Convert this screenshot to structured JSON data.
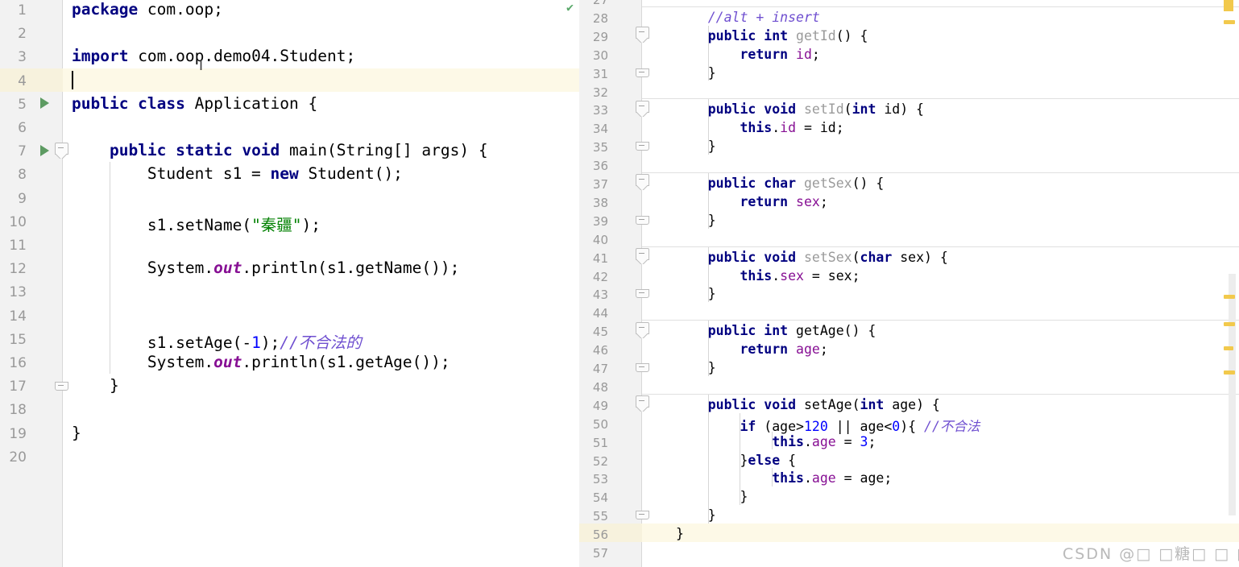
{
  "editor": {
    "left_pane": {
      "first_line": 1,
      "caret_line": 4,
      "run_marker_lines": [
        5,
        7
      ],
      "lines": [
        {
          "n": 1,
          "tokens": [
            {
              "t": "package",
              "c": "kw"
            },
            {
              "t": " com.oop;",
              "c": "pl"
            }
          ]
        },
        {
          "n": 2,
          "tokens": []
        },
        {
          "n": 3,
          "tokens": [
            {
              "t": "import",
              "c": "kw"
            },
            {
              "t": " com.oop.demo04.Student;",
              "c": "pl"
            }
          ]
        },
        {
          "n": 4,
          "tokens": []
        },
        {
          "n": 5,
          "tokens": [
            {
              "t": "public class",
              "c": "kw"
            },
            {
              "t": " Application {",
              "c": "pl"
            }
          ]
        },
        {
          "n": 6,
          "tokens": []
        },
        {
          "n": 7,
          "tokens": [
            {
              "t": "    ",
              "c": "pl"
            },
            {
              "t": "public static void",
              "c": "kw"
            },
            {
              "t": " main(String[] args) {",
              "c": "pl"
            }
          ]
        },
        {
          "n": 8,
          "tokens": [
            {
              "t": "        Student s1 = ",
              "c": "pl"
            },
            {
              "t": "new",
              "c": "kw"
            },
            {
              "t": " Student();",
              "c": "pl"
            }
          ]
        },
        {
          "n": 9,
          "tokens": []
        },
        {
          "n": 10,
          "tokens": [
            {
              "t": "        s1.setName(",
              "c": "pl"
            },
            {
              "t": "\"秦疆\"",
              "c": "str"
            },
            {
              "t": ");",
              "c": "pl"
            }
          ]
        },
        {
          "n": 11,
          "tokens": []
        },
        {
          "n": 12,
          "tokens": [
            {
              "t": "        System.",
              "c": "pl"
            },
            {
              "t": "out",
              "c": "sfield"
            },
            {
              "t": ".println(s1.getName());",
              "c": "pl"
            }
          ]
        },
        {
          "n": 13,
          "tokens": []
        },
        {
          "n": 14,
          "tokens": []
        },
        {
          "n": 15,
          "tokens": [
            {
              "t": "        s1.setAge(-",
              "c": "pl"
            },
            {
              "t": "1",
              "c": "num"
            },
            {
              "t": ");",
              "c": "pl"
            },
            {
              "t": "//不合法的",
              "c": "cmt"
            }
          ]
        },
        {
          "n": 16,
          "tokens": [
            {
              "t": "        System.",
              "c": "pl"
            },
            {
              "t": "out",
              "c": "sfield"
            },
            {
              "t": ".println(s1.getAge());",
              "c": "pl"
            }
          ]
        },
        {
          "n": 17,
          "tokens": [
            {
              "t": "    }",
              "c": "pl"
            }
          ]
        },
        {
          "n": 18,
          "tokens": []
        },
        {
          "n": 19,
          "tokens": [
            {
              "t": "}",
              "c": "pl"
            }
          ]
        },
        {
          "n": 20,
          "tokens": []
        }
      ]
    },
    "right_pane": {
      "first_line": 27,
      "caret_line": 56,
      "lines": [
        {
          "n": 27,
          "tokens": []
        },
        {
          "n": 28,
          "tokens": [
            {
              "t": "    ",
              "c": "pl"
            },
            {
              "t": "//alt + insert",
              "c": "cmt"
            }
          ]
        },
        {
          "n": 29,
          "tokens": [
            {
              "t": "    ",
              "c": "pl"
            },
            {
              "t": "public int",
              "c": "kw"
            },
            {
              "t": " ",
              "c": "pl"
            },
            {
              "t": "getId",
              "c": "mth"
            },
            {
              "t": "() {",
              "c": "pl"
            }
          ]
        },
        {
          "n": 30,
          "tokens": [
            {
              "t": "        ",
              "c": "pl"
            },
            {
              "t": "return",
              "c": "kw"
            },
            {
              "t": " ",
              "c": "pl"
            },
            {
              "t": "id",
              "c": "fld"
            },
            {
              "t": ";",
              "c": "pl"
            }
          ]
        },
        {
          "n": 31,
          "tokens": [
            {
              "t": "    }",
              "c": "pl"
            }
          ]
        },
        {
          "n": 32,
          "tokens": []
        },
        {
          "n": 33,
          "tokens": [
            {
              "t": "    ",
              "c": "pl"
            },
            {
              "t": "public void",
              "c": "kw"
            },
            {
              "t": " ",
              "c": "pl"
            },
            {
              "t": "setId",
              "c": "mth"
            },
            {
              "t": "(",
              "c": "pl"
            },
            {
              "t": "int",
              "c": "kw"
            },
            {
              "t": " id) {",
              "c": "pl"
            }
          ]
        },
        {
          "n": 34,
          "tokens": [
            {
              "t": "        ",
              "c": "pl"
            },
            {
              "t": "this",
              "c": "kw"
            },
            {
              "t": ".",
              "c": "pl"
            },
            {
              "t": "id",
              "c": "fld"
            },
            {
              "t": " = id;",
              "c": "pl"
            }
          ]
        },
        {
          "n": 35,
          "tokens": [
            {
              "t": "    }",
              "c": "pl"
            }
          ]
        },
        {
          "n": 36,
          "tokens": []
        },
        {
          "n": 37,
          "tokens": [
            {
              "t": "    ",
              "c": "pl"
            },
            {
              "t": "public char",
              "c": "kw"
            },
            {
              "t": " ",
              "c": "pl"
            },
            {
              "t": "getSex",
              "c": "mth"
            },
            {
              "t": "() {",
              "c": "pl"
            }
          ]
        },
        {
          "n": 38,
          "tokens": [
            {
              "t": "        ",
              "c": "pl"
            },
            {
              "t": "return",
              "c": "kw"
            },
            {
              "t": " ",
              "c": "pl"
            },
            {
              "t": "sex",
              "c": "fld"
            },
            {
              "t": ";",
              "c": "pl"
            }
          ]
        },
        {
          "n": 39,
          "tokens": [
            {
              "t": "    }",
              "c": "pl"
            }
          ]
        },
        {
          "n": 40,
          "tokens": []
        },
        {
          "n": 41,
          "tokens": [
            {
              "t": "    ",
              "c": "pl"
            },
            {
              "t": "public void",
              "c": "kw"
            },
            {
              "t": " ",
              "c": "pl"
            },
            {
              "t": "setSex",
              "c": "mth"
            },
            {
              "t": "(",
              "c": "pl"
            },
            {
              "t": "char",
              "c": "kw"
            },
            {
              "t": " sex) {",
              "c": "pl"
            }
          ]
        },
        {
          "n": 42,
          "tokens": [
            {
              "t": "        ",
              "c": "pl"
            },
            {
              "t": "this",
              "c": "kw"
            },
            {
              "t": ".",
              "c": "pl"
            },
            {
              "t": "sex",
              "c": "fld"
            },
            {
              "t": " = sex;",
              "c": "pl"
            }
          ]
        },
        {
          "n": 43,
          "tokens": [
            {
              "t": "    }",
              "c": "pl"
            }
          ]
        },
        {
          "n": 44,
          "tokens": []
        },
        {
          "n": 45,
          "tokens": [
            {
              "t": "    ",
              "c": "pl"
            },
            {
              "t": "public int",
              "c": "kw"
            },
            {
              "t": " getAge() {",
              "c": "pl"
            }
          ]
        },
        {
          "n": 46,
          "tokens": [
            {
              "t": "        ",
              "c": "pl"
            },
            {
              "t": "return",
              "c": "kw"
            },
            {
              "t": " ",
              "c": "pl"
            },
            {
              "t": "age",
              "c": "fld"
            },
            {
              "t": ";",
              "c": "pl"
            }
          ]
        },
        {
          "n": 47,
          "tokens": [
            {
              "t": "    }",
              "c": "pl"
            }
          ]
        },
        {
          "n": 48,
          "tokens": []
        },
        {
          "n": 49,
          "tokens": [
            {
              "t": "    ",
              "c": "pl"
            },
            {
              "t": "public void",
              "c": "kw"
            },
            {
              "t": " setAge(",
              "c": "pl"
            },
            {
              "t": "int",
              "c": "kw"
            },
            {
              "t": " age) {",
              "c": "pl"
            }
          ]
        },
        {
          "n": 50,
          "tokens": [
            {
              "t": "        ",
              "c": "pl"
            },
            {
              "t": "if",
              "c": "kw"
            },
            {
              "t": " (age>",
              "c": "pl"
            },
            {
              "t": "120",
              "c": "num"
            },
            {
              "t": " || age<",
              "c": "pl"
            },
            {
              "t": "0",
              "c": "num"
            },
            {
              "t": "){ ",
              "c": "pl"
            },
            {
              "t": "//不合法",
              "c": "cmt"
            }
          ]
        },
        {
          "n": 51,
          "tokens": [
            {
              "t": "            ",
              "c": "pl"
            },
            {
              "t": "this",
              "c": "kw"
            },
            {
              "t": ".",
              "c": "pl"
            },
            {
              "t": "age",
              "c": "fld"
            },
            {
              "t": " = ",
              "c": "pl"
            },
            {
              "t": "3",
              "c": "num"
            },
            {
              "t": ";",
              "c": "pl"
            }
          ]
        },
        {
          "n": 52,
          "tokens": [
            {
              "t": "        }",
              "c": "pl"
            },
            {
              "t": "else",
              "c": "kw"
            },
            {
              "t": " {",
              "c": "pl"
            }
          ]
        },
        {
          "n": 53,
          "tokens": [
            {
              "t": "            ",
              "c": "pl"
            },
            {
              "t": "this",
              "c": "kw"
            },
            {
              "t": ".",
              "c": "pl"
            },
            {
              "t": "age",
              "c": "fld"
            },
            {
              "t": " = age;",
              "c": "pl"
            }
          ]
        },
        {
          "n": 54,
          "tokens": [
            {
              "t": "        }",
              "c": "pl"
            }
          ]
        },
        {
          "n": 55,
          "tokens": [
            {
              "t": "    }",
              "c": "pl"
            }
          ]
        },
        {
          "n": 56,
          "tokens": [
            {
              "t": "}",
              "c": "pl"
            }
          ]
        },
        {
          "n": 57,
          "tokens": []
        }
      ]
    }
  },
  "inspection": {
    "status_icon": "checkmark-icon",
    "status_glyph": "✔",
    "ok_color": "#59a869",
    "warning_color": "#f2c94c",
    "warning_marker_count": 6
  },
  "watermark": {
    "text": "CSDN @□ □糖□ □ □",
    "color": "#b9b9b9"
  },
  "colors": {
    "background": "#ffffff",
    "gutter": "#f2f2f2",
    "line_number": "#999999",
    "caret_line": "#fdf9e7",
    "keyword": "#000080",
    "string": "#008000",
    "number": "#0000ff",
    "comment": "#6f4fd0",
    "field": "#871094",
    "method_declaration": "#9a9a9a",
    "plain": "#000000"
  }
}
